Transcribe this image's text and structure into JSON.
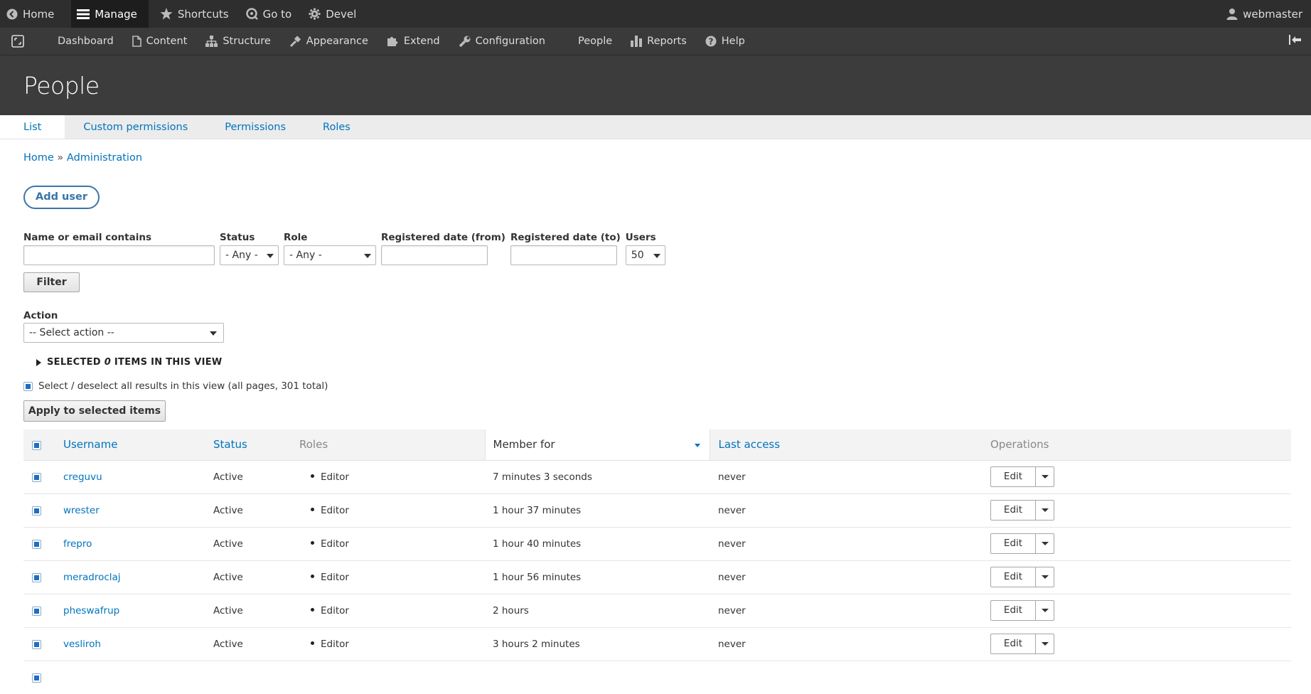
{
  "toolbar": {
    "home": "Home",
    "manage": "Manage",
    "shortcuts": "Shortcuts",
    "goto": "Go to",
    "devel": "Devel",
    "user": "webmaster"
  },
  "tray": [
    "Dashboard",
    "Content",
    "Structure",
    "Appearance",
    "Extend",
    "Configuration",
    "People",
    "Reports",
    "Help"
  ],
  "page": {
    "title": "People"
  },
  "tabs": [
    "List",
    "Custom permissions",
    "Permissions",
    "Roles"
  ],
  "breadcrumb": {
    "home": "Home",
    "sep": " » ",
    "admin": "Administration"
  },
  "add_user": "Add user",
  "filters": {
    "name_label": "Name or email contains",
    "status_label": "Status",
    "status_value": "- Any -",
    "role_label": "Role",
    "role_value": "- Any -",
    "from_label": "Registered date (from)",
    "to_label": "Registered date (to)",
    "users_label": "Users",
    "users_value": "50",
    "filter_button": "Filter"
  },
  "action": {
    "label": "Action",
    "value": "-- Select action --"
  },
  "summary": {
    "prefix": "SELECTED ",
    "count": "0",
    "suffix": " ITEMS IN THIS VIEW"
  },
  "select_all": "Select / deselect all results in this view (all pages, 301 total)",
  "apply_button": "Apply to selected items",
  "table": {
    "headers": [
      "Username",
      "Status",
      "Roles",
      "Member for",
      "Last access",
      "Operations"
    ],
    "rows": [
      {
        "username": "creguvu",
        "status": "Active",
        "role": "Editor",
        "member_for": "7 minutes 3 seconds",
        "last_access": "never",
        "edit": "Edit"
      },
      {
        "username": "wrester",
        "status": "Active",
        "role": "Editor",
        "member_for": "1 hour 37 minutes",
        "last_access": "never",
        "edit": "Edit"
      },
      {
        "username": "frepro",
        "status": "Active",
        "role": "Editor",
        "member_for": "1 hour 40 minutes",
        "last_access": "never",
        "edit": "Edit"
      },
      {
        "username": "meradroclaj",
        "status": "Active",
        "role": "Editor",
        "member_for": "1 hour 56 minutes",
        "last_access": "never",
        "edit": "Edit"
      },
      {
        "username": "pheswafrup",
        "status": "Active",
        "role": "Editor",
        "member_for": "2 hours",
        "last_access": "never",
        "edit": "Edit"
      },
      {
        "username": "vesliroh",
        "status": "Active",
        "role": "Editor",
        "member_for": "3 hours 2 minutes",
        "last_access": "never",
        "edit": "Edit"
      },
      {
        "username": "",
        "status": "",
        "role": "",
        "member_for": "",
        "last_access": "",
        "edit": ""
      }
    ]
  }
}
